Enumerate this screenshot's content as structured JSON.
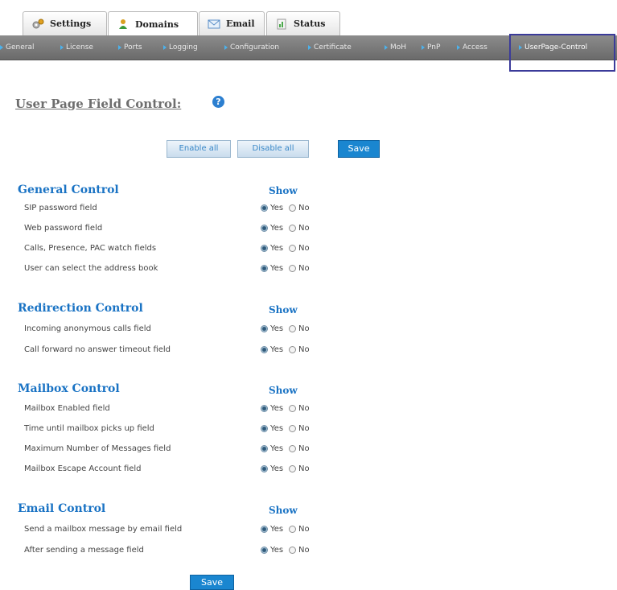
{
  "tabs": [
    {
      "label": "Settings",
      "icon": "settings-icon"
    },
    {
      "label": "Domains",
      "icon": "domains-icon"
    },
    {
      "label": "Email",
      "icon": "email-icon"
    },
    {
      "label": "Status",
      "icon": "status-icon"
    }
  ],
  "nav": [
    "General",
    "License",
    "Ports",
    "Logging",
    "Configuration",
    "Certificate",
    "MoH",
    "PnP",
    "Access",
    "UserPage-Control"
  ],
  "page": {
    "title": "User Page Field Control:",
    "help_icon": "?"
  },
  "buttons": {
    "enable_all": "Enable all",
    "disable_all": "Disable all",
    "save": "Save"
  },
  "show_label": "Show",
  "option_yes": "Yes",
  "option_no": "No",
  "sections": [
    {
      "title": "General Control",
      "fields": [
        {
          "label": "SIP password field",
          "value": "Yes"
        },
        {
          "label": "Web password field",
          "value": "Yes"
        },
        {
          "label": "Calls, Presence, PAC watch fields",
          "value": "Yes"
        },
        {
          "label": "User can select the address book",
          "value": "Yes"
        }
      ]
    },
    {
      "title": "Redirection Control",
      "fields": [
        {
          "label": "Incoming anonymous calls field",
          "value": "Yes"
        },
        {
          "label": "Call forward no answer timeout field",
          "value": "Yes"
        }
      ]
    },
    {
      "title": "Mailbox Control",
      "fields": [
        {
          "label": "Mailbox Enabled field",
          "value": "Yes"
        },
        {
          "label": "Time until mailbox picks up field",
          "value": "Yes"
        },
        {
          "label": "Maximum Number of Messages field",
          "value": "Yes"
        },
        {
          "label": "Mailbox Escape Account field",
          "value": "Yes"
        }
      ]
    },
    {
      "title": "Email Control",
      "fields": [
        {
          "label": "Send a mailbox message by email field",
          "value": "Yes"
        },
        {
          "label": "After sending a message field",
          "value": "Yes"
        }
      ]
    }
  ],
  "colors": {
    "accent": "#1a73c4",
    "save": "#1a86d0",
    "nav": "#7a7a7a"
  }
}
